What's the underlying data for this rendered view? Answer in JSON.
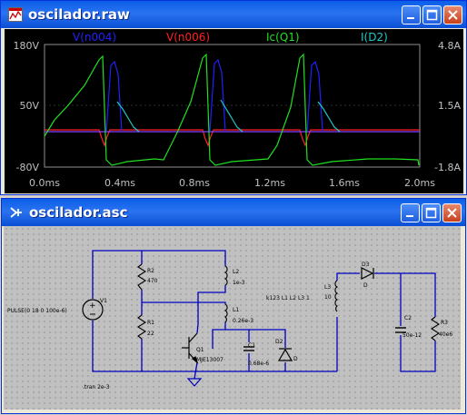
{
  "waveform_window": {
    "title": "osciladorraw",
    "title_display": "oscilador.raw",
    "legend": [
      {
        "label": "V(n004)",
        "color": "#2020ff"
      },
      {
        "label": "V(n006)",
        "color": "#ff2020"
      },
      {
        "label": "Ic(Q1)",
        "color": "#20e020"
      },
      {
        "label": "I(D2)",
        "color": "#20c8c8"
      }
    ],
    "left_axis_ticks": [
      "180V",
      "50V",
      "-80V"
    ],
    "right_axis_ticks": [
      "4.8A",
      "1.5A",
      "-1.8A"
    ],
    "x_axis_ticks": [
      "0.0ms",
      "0.4ms",
      "0.8ms",
      "1.2ms",
      "1.6ms",
      "2.0ms"
    ]
  },
  "schematic_window": {
    "title": "oscilador.asc",
    "labels": {
      "source_spec": "PULSE(0 18 0 100e-6)",
      "v1": "V1",
      "r2": "R2",
      "r2_val": "470",
      "r1": "R1",
      "r1_val": "22",
      "l2": "L2",
      "l2_val": "1e-3",
      "l1": "L1",
      "l1_val": "0.26e-3",
      "q1": "Q1",
      "q1_val": "MJE13007",
      "c1": "C1",
      "c1_val": "0.68e-6",
      "d2": "D2",
      "d2_val": "D",
      "k": "k123 L1 L2 L3 1",
      "l3": "L3",
      "l3_val": "10",
      "d3": "D3",
      "d3_val": "D",
      "c2": "C2",
      "c2_val": "50e-12",
      "r3": "R3",
      "r3_val": "40e6",
      "tran": ".tran 2e-3"
    }
  },
  "colors": {
    "titlebar": "#0a5ee8",
    "wire": "#0000c0",
    "component": "#000000",
    "plot_bg": "#000000"
  }
}
